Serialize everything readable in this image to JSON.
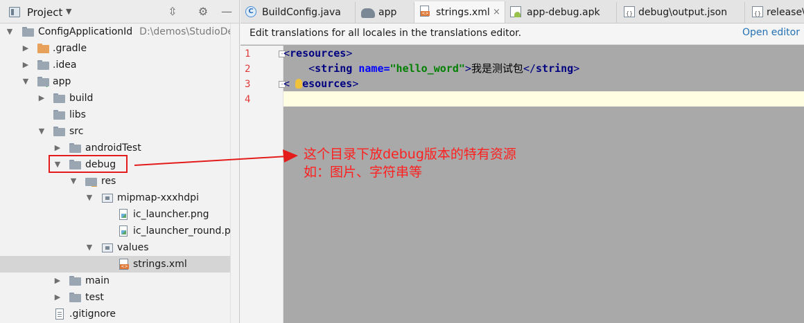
{
  "project_panel": {
    "title": "Project",
    "tree": [
      {
        "label": "ConfigApplicationId",
        "path": "D:\\demos\\StudioDem"
      },
      {
        "label": ".gradle"
      },
      {
        "label": ".idea"
      },
      {
        "label": "app"
      },
      {
        "label": "build"
      },
      {
        "label": "libs"
      },
      {
        "label": "src"
      },
      {
        "label": "androidTest"
      },
      {
        "label": "debug"
      },
      {
        "label": "res"
      },
      {
        "label": "mipmap-xxxhdpi"
      },
      {
        "label": "ic_launcher.png"
      },
      {
        "label": "ic_launcher_round.png"
      },
      {
        "label": "values"
      },
      {
        "label": "strings.xml"
      },
      {
        "label": "main"
      },
      {
        "label": "test"
      },
      {
        "label": ".gitignore"
      }
    ]
  },
  "tabs": [
    {
      "label": "BuildConfig.java",
      "icon": "class-icon"
    },
    {
      "label": "app",
      "icon": "gradle-icon"
    },
    {
      "label": "strings.xml",
      "icon": "xml-file-icon",
      "active": true
    },
    {
      "label": "app-debug.apk",
      "icon": "apk-icon"
    },
    {
      "label": "debug\\output.json",
      "icon": "json-icon"
    },
    {
      "label": "release\\",
      "icon": "json-icon"
    }
  ],
  "editor": {
    "notice": "Edit translations for all locales in the translations editor.",
    "open_editor": "Open editor",
    "line_numbers": [
      "1",
      "2",
      "3",
      "4"
    ],
    "code": {
      "l1_open": "<",
      "l1_tag": "resources",
      "l1_close": ">",
      "l2_indent": "    <",
      "l2_tag": "string",
      "l2_attr": "name=",
      "l2_val": "\"hello_word\"",
      "l2_gt": ">",
      "l2_text": "我是测试包",
      "l2_end_open": "</",
      "l2_end_tag": "string",
      "l2_end_close": ">",
      "l3_open": "<",
      "l3_slash": "/",
      "l3_tag": "resources",
      "l3_close": ">"
    }
  },
  "annotation": {
    "line1": "这个目录下放debug版本的特有资源",
    "line2": "如：图片、字符串等",
    "color": "#ff2020"
  }
}
